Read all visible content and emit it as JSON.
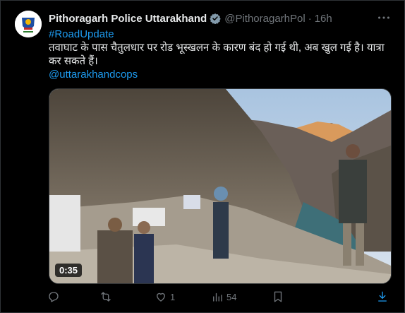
{
  "tweet": {
    "author_name": "Pithoragarh Police Uttarakhand",
    "handle": "@PithoragarhPol",
    "separator": "·",
    "time": "16h",
    "hashtag": "#RoadUpdate",
    "body": "तवाघाट के पास चैतुलधार पर रोड भूस्खलन के कारण बंद हो गई थी, अब खुल गई है। यात्रा कर सकते हैं।",
    "mention": "@uttarakhandcops",
    "video_duration": "0:35"
  },
  "actions": {
    "reply_count": "",
    "retweet_count": "",
    "like_count": "1",
    "views_count": "54"
  },
  "colors": {
    "link": "#1d9bf0",
    "muted": "#71767b",
    "text": "#e7e9ea",
    "verified": "#829aab"
  },
  "icons": [
    "avatar-logo",
    "verified-badge-icon",
    "more-icon",
    "reply-icon",
    "retweet-icon",
    "like-icon",
    "views-icon",
    "bookmark-icon",
    "share-icon"
  ]
}
